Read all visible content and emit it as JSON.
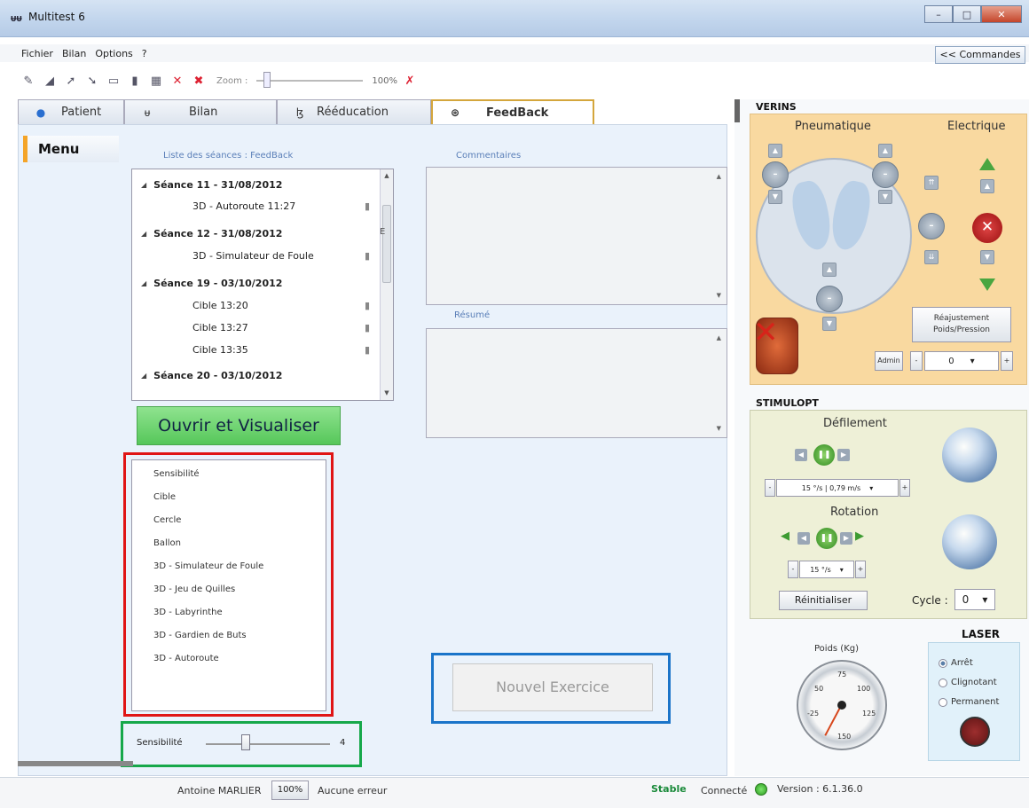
{
  "window": {
    "logo": "ᵾᵾ",
    "title": "Multitest 6",
    "min": "–",
    "max": "□",
    "close": "✕"
  },
  "menu": [
    "Fichier",
    "Bilan",
    "Options",
    "?"
  ],
  "commands_button": "<< Commandes",
  "toolbar": {
    "zoom_label": "Zoom :",
    "zoom_value": "100%"
  },
  "tabs": [
    {
      "label": "Patient",
      "icon": "person-icon"
    },
    {
      "label": "Bilan",
      "icon": "feet-icon"
    },
    {
      "label": "Rééducation",
      "icon": "walker-icon"
    },
    {
      "label": "FeedBack",
      "icon": "target-icon",
      "active": true
    }
  ],
  "sidebar": {
    "menu_label": "Menu"
  },
  "sessions": {
    "header": "Liste des séances :  FeedBack",
    "groups": [
      {
        "title": "Séance 11 - 31/08/2012",
        "children": [
          "3D - Autoroute 11:27"
        ]
      },
      {
        "title": "Séance 12 - 31/08/2012",
        "children": [
          "3D - Simulateur de Foule"
        ]
      },
      {
        "title": "Séance 19 - 03/10/2012",
        "children": [
          "Cible 13:20",
          "Cible 13:27",
          "Cible 13:35"
        ]
      },
      {
        "title": "Séance 20 - 03/10/2012",
        "children": []
      }
    ],
    "scroll_marker": "E"
  },
  "comments_label": "Commentaires",
  "summary_label": "Résumé",
  "open_button": "Ouvrir et Visualiser",
  "exercises": [
    "Sensibilité",
    "Cible",
    "Cercle",
    "Ballon",
    "3D - Simulateur de Foule",
    "3D - Jeu de Quilles",
    "3D - Labyrinthe",
    "3D - Gardien de Buts",
    "3D - Autoroute"
  ],
  "sensitivity": {
    "label": "Sensibilité",
    "value": "4"
  },
  "new_exercise_button": "Nouvel Exercice",
  "verins": {
    "title": "VERINS",
    "pneumatic": "Pneumatique",
    "electric": "Electrique",
    "readjust_line1": "Réajustement",
    "readjust_line2": "Poids/Pression",
    "admin": "Admin",
    "pressure_value": "0"
  },
  "stimulopt": {
    "title": "STIMULOPT",
    "scroll_label": "Défilement",
    "scroll_speed": "15 °/s  |  0,79 m/s",
    "rotation_label": "Rotation",
    "rotation_speed": "15 °/s",
    "reset_button": "Réinitialiser",
    "cycle_label": "Cycle :",
    "cycle_value": "0"
  },
  "gauge": {
    "label": "Poids (Kg)",
    "ticks": [
      "75",
      "50",
      "100",
      "-25",
      "125",
      "150"
    ]
  },
  "laser": {
    "title": "LASER",
    "options": [
      "Arrêt",
      "Clignotant",
      "Permanent"
    ],
    "selected": "Arrêt"
  },
  "status": {
    "user": "Antoine MARLIER",
    "zoom": "100%",
    "errors": "Aucune erreur",
    "stable": "Stable",
    "connection": "Connecté",
    "version": "Version : 6.1.36.0"
  },
  "colors": {
    "accent_orange": "#f4a428",
    "open_green": "#56c75a",
    "highlight_red": "#e01515",
    "highlight_green": "#16a84a",
    "highlight_blue": "#1a74c9"
  }
}
